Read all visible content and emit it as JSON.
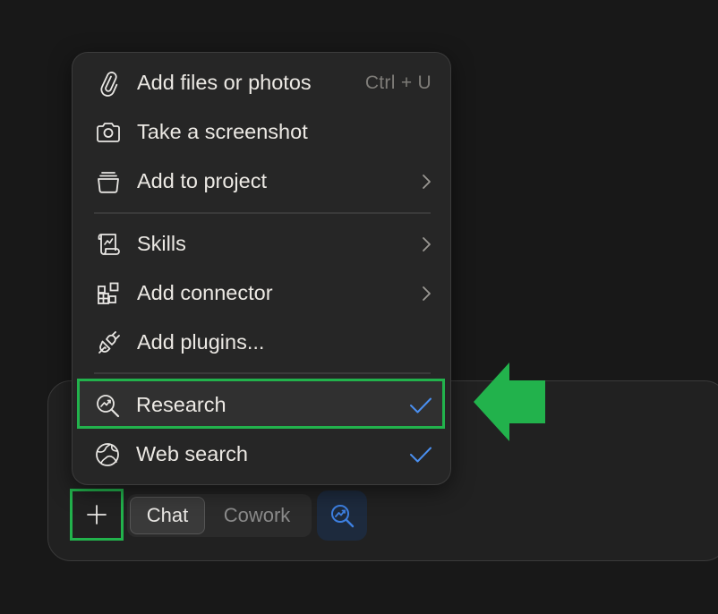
{
  "menu": {
    "items": [
      {
        "label": "Add files or photos",
        "icon": "paperclip-icon",
        "shortcut": "Ctrl + U"
      },
      {
        "label": "Take a screenshot",
        "icon": "camera-icon"
      },
      {
        "label": "Add to project",
        "icon": "project-box-icon",
        "submenu": true
      },
      {
        "label": "Skills",
        "icon": "scroll-icon",
        "submenu": true
      },
      {
        "label": "Add connector",
        "icon": "blocks-icon",
        "submenu": true
      },
      {
        "label": "Add plugins...",
        "icon": "plug-icon"
      },
      {
        "label": "Research",
        "icon": "research-icon",
        "checked": true
      },
      {
        "label": "Web search",
        "icon": "globe-icon",
        "checked": true
      }
    ]
  },
  "composer": {
    "modes": [
      "Chat",
      "Cowork"
    ],
    "selected_mode": "Chat"
  },
  "colors": {
    "background": "#181818",
    "menu_bg": "#262626",
    "annotation_green": "#22b24c",
    "check_blue": "#4a8ff0"
  }
}
